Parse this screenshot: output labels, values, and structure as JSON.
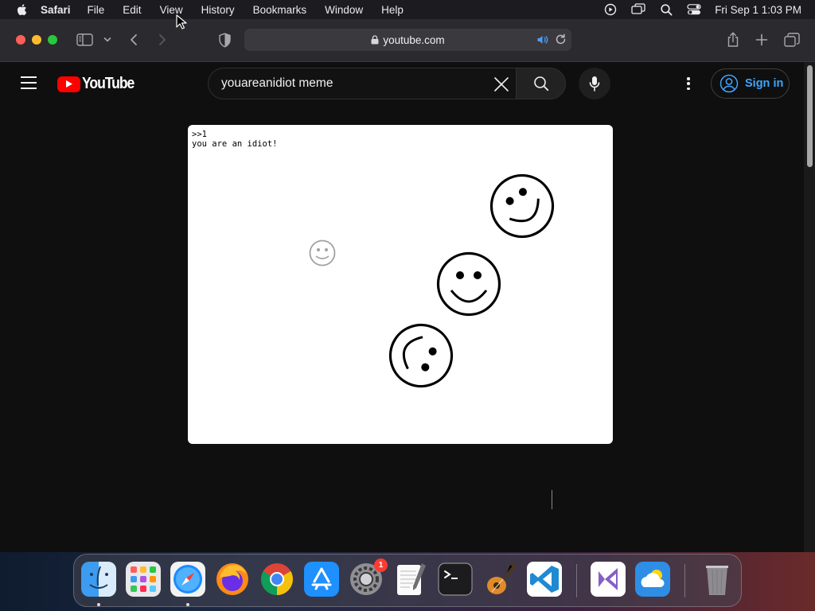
{
  "menubar": {
    "app_name": "Safari",
    "items": [
      "File",
      "Edit",
      "View",
      "History",
      "Bookmarks",
      "Window",
      "Help"
    ],
    "status_icons": [
      "screen-recording-icon",
      "screen-mirroring-icon",
      "spotlight-icon",
      "control-center-icon"
    ],
    "clock": "Fri Sep 1  1:03 PM"
  },
  "safari": {
    "url": "youtube.com",
    "tab_audio_playing": true
  },
  "youtube": {
    "logo_text": "YouTube",
    "search_query": "youareanidiot meme",
    "sign_in_label": "Sign in",
    "colors": {
      "brand_red": "#ff0000",
      "sign_in_blue": "#3ea6ff"
    }
  },
  "video": {
    "console_prompt": ">>1",
    "console_text": "you are an idiot!"
  },
  "dock": {
    "apps": [
      "Finder",
      "Launchpad",
      "Safari",
      "Firefox",
      "Google Chrome",
      "App Store",
      "System Settings",
      "TextEdit",
      "Terminal",
      "GarageBand",
      "Visual Studio Code",
      "Visual Studio",
      "Weather",
      "Trash"
    ],
    "system_settings_badge": "1"
  }
}
